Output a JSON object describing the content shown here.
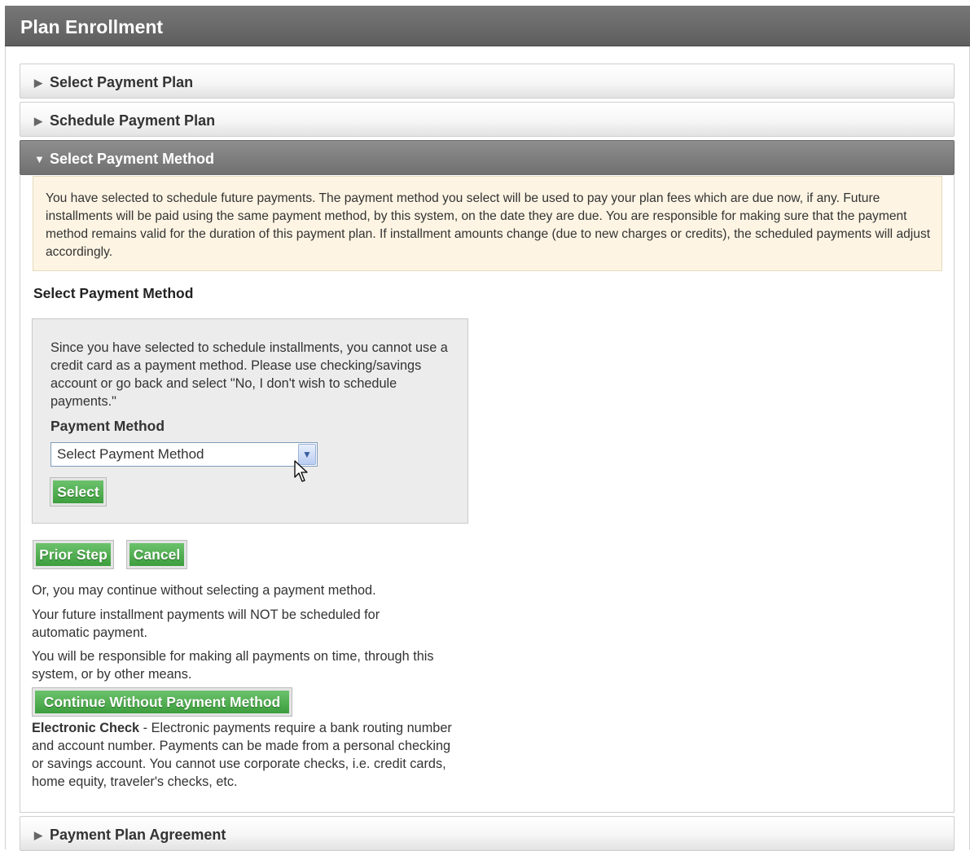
{
  "header": {
    "title": "Plan Enrollment"
  },
  "accordion": {
    "sections": [
      {
        "label": "Select Payment Plan",
        "arrow": "▶"
      },
      {
        "label": "Schedule Payment Plan",
        "arrow": "▶"
      },
      {
        "label": "Select Payment Method",
        "arrow": "▼"
      },
      {
        "label": "Payment Plan Agreement",
        "arrow": "▶"
      }
    ]
  },
  "notice": {
    "text": "You have selected to schedule future payments. The payment method you select will be used to pay your plan fees which are due now, if any. Future installments will be paid using the same payment method, by this system, on the date they are due. You are responsible for making sure that the payment method remains valid for the duration of this payment plan. If installment amounts change (due to new charges or credits), the scheduled payments will adjust accordingly."
  },
  "method_section": {
    "title": "Select Payment Method",
    "message": "Since you have selected to schedule installments, you cannot use a credit card as a payment method. Please use checking/savings account or go back and select \"No, I don't wish to schedule payments.\"",
    "field_label": "Payment Method",
    "select_value": "Select Payment Method",
    "select_button": "Select"
  },
  "nav": {
    "prior_step": "Prior Step",
    "cancel": "Cancel"
  },
  "continue_info": {
    "line1": "Or, you may continue without selecting a payment method.",
    "line2": "Your future installment payments will NOT be scheduled for automatic payment.",
    "line3": "You will be responsible for making all payments on time, through this system, or by other means.",
    "button": "Continue Without Payment Method"
  },
  "echeck": {
    "title": "Electronic Check",
    "text": " - Electronic payments require a bank routing number and account number. Payments can be made from a personal checking or savings account. You cannot use corporate checks, i.e. credit cards, home equity, traveler's checks, etc."
  },
  "icons": {
    "collapsed": "triangle-right-icon",
    "expanded": "triangle-down-icon",
    "dropdown": "chevron-down-icon",
    "pointer": "mouse-pointer-icon"
  },
  "colors": {
    "header": "#666666",
    "button_green": "#4caf4c",
    "notice_bg": "#fdf4e3"
  }
}
